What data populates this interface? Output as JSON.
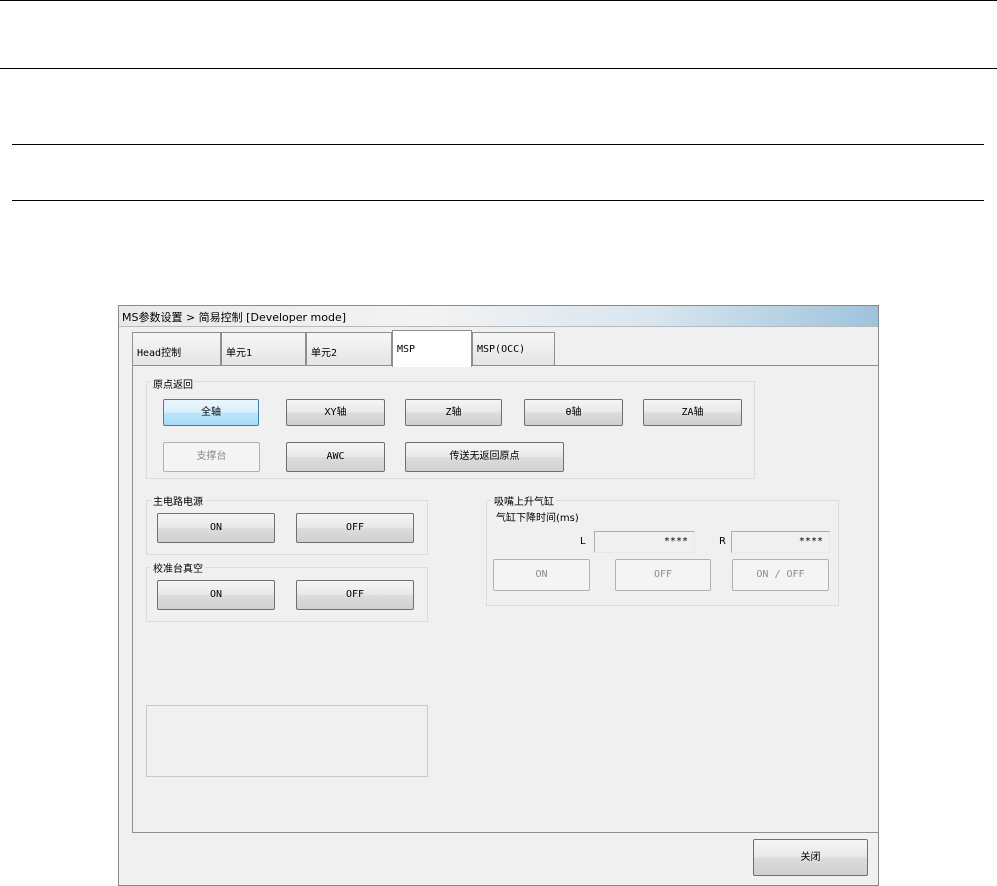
{
  "window": {
    "title": "MS参数设置 > 简易控制 [Developer mode]"
  },
  "tabs": [
    {
      "label": "Head控制"
    },
    {
      "label": "单元1"
    },
    {
      "label": "单元2"
    },
    {
      "label": "MSP"
    },
    {
      "label": "MSP(OCC)"
    }
  ],
  "active_tab": "MSP",
  "origin_return": {
    "label": "原点返回",
    "buttons": {
      "all_axis": "全轴",
      "xy_axis": "XY轴",
      "z_axis": "Z轴",
      "theta_axis": "θ轴",
      "za_axis": "ZA轴",
      "support_table": "支撑台",
      "awc": "AWC",
      "conveyor_no_return": "传送无返回原点"
    }
  },
  "main_power": {
    "label": "主电路电源",
    "on": "ON",
    "off": "OFF"
  },
  "calib_vacuum": {
    "label": "校准台真空",
    "on": "ON",
    "off": "OFF"
  },
  "nozzle_cylinder": {
    "label": "吸嘴上升气缸",
    "time_label": "气缸下降时间(ms)",
    "left_label": "L",
    "left_value": "****",
    "right_label": "R",
    "right_value": "****",
    "on": "ON",
    "off": "OFF",
    "toggle": "ON / OFF"
  },
  "footer": {
    "close": "关闭"
  },
  "colors": {
    "focus_border": "#3c7fb1",
    "title_gradient_end": "#9fc3dc"
  }
}
